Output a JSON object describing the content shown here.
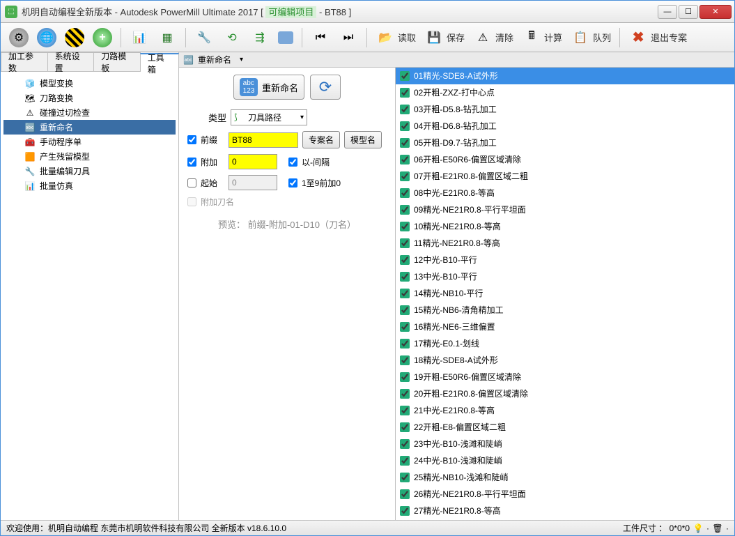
{
  "window_title_prefix": "机明自动编程全新版本 - Autodesk PowerMill Ultimate 2017   [ ",
  "window_title_proj_label": "可编辑项目",
  "window_title_proj_suffix": " - BT88 ]",
  "toolbar_actions": {
    "read": "读取",
    "save": "保存",
    "clear": "清除",
    "calc": "计算",
    "queue": "队列",
    "exit": "退出专案"
  },
  "tabs": [
    "加工参数",
    "系统设置",
    "刀路模板",
    "工具箱"
  ],
  "active_tab_index": 3,
  "tree_items": [
    {
      "icon": "🧊",
      "label": "模型变换"
    },
    {
      "icon": "🗺",
      "label": "刀路变换"
    },
    {
      "icon": "⚠",
      "label": "碰撞过切检查"
    },
    {
      "icon": "🔤",
      "label": "重新命名",
      "selected": true
    },
    {
      "icon": "🧰",
      "label": "手动程序单"
    },
    {
      "icon": "🟧",
      "label": "产生残留模型"
    },
    {
      "icon": "🔧",
      "label": "批量编辑刀具"
    },
    {
      "icon": "📊",
      "label": "批量仿真"
    }
  ],
  "panel_header": "重新命名",
  "rename_button": "重新命名",
  "form": {
    "type_label": "类型",
    "type_value": "刀具路径",
    "prefix_checked": true,
    "prefix_label": "前缀",
    "prefix_value": "BT88",
    "project_btn": "专案名",
    "model_btn": "模型名",
    "append_checked": true,
    "append_label": "附加",
    "append_value": "0",
    "interval_checked": true,
    "interval_label": "以-间隔",
    "start_checked": false,
    "start_label": "起始",
    "start_value": "0",
    "pad_checked": true,
    "pad_label": "1至9前加0",
    "tool_name_checked": false,
    "tool_name_label": "附加刀名",
    "preview": "预览： 前缀-附加-01-D10（刀名）"
  },
  "list_items": [
    {
      "label": "01精光-SDE8-A试外形",
      "selected": true
    },
    {
      "label": "02开粗-ZXZ-打中心点"
    },
    {
      "label": "03开粗-D5.8-钻孔加工"
    },
    {
      "label": "04开粗-D6.8-钻孔加工"
    },
    {
      "label": "05开粗-D9.7-钻孔加工"
    },
    {
      "label": "06开粗-E50R6-偏置区域清除"
    },
    {
      "label": "07开粗-E21R0.8-偏置区域二粗"
    },
    {
      "label": "08中光-E21R0.8-等高"
    },
    {
      "label": "09精光-NE21R0.8-平行平坦面"
    },
    {
      "label": "10精光-NE21R0.8-等高"
    },
    {
      "label": "11精光-NE21R0.8-等高"
    },
    {
      "label": "12中光-B10-平行"
    },
    {
      "label": "13中光-B10-平行"
    },
    {
      "label": "14精光-NB10-平行"
    },
    {
      "label": "15精光-NB6-清角精加工"
    },
    {
      "label": "16精光-NE6-三维偏置"
    },
    {
      "label": "17精光-E0.1-划线"
    },
    {
      "label": "18精光-SDE8-A试外形"
    },
    {
      "label": "19开粗-E50R6-偏置区域清除"
    },
    {
      "label": "20开粗-E21R0.8-偏置区域清除"
    },
    {
      "label": "21中光-E21R0.8-等高"
    },
    {
      "label": "22开粗-E8-偏置区域二粗"
    },
    {
      "label": "23中光-B10-浅滩和陡峭"
    },
    {
      "label": "24中光-B10-浅滩和陡峭"
    },
    {
      "label": "25精光-NB10-浅滩和陡峭"
    },
    {
      "label": "26精光-NE21R0.8-平行平坦面"
    },
    {
      "label": "27精光-NE21R0.8-等高"
    }
  ],
  "status_left": "欢迎使用：机明自动编程 东莞市机明软件科技有限公司 全新版本  v18.6.10.0",
  "status_right": "工件尺寸 ：  0*0*0"
}
